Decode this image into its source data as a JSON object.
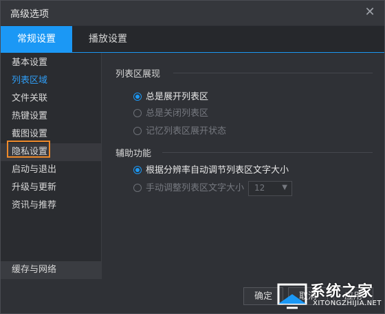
{
  "window": {
    "title": "高级选项",
    "close_glyph": "✕"
  },
  "tabs": [
    {
      "label": "常规设置",
      "active": true
    },
    {
      "label": "播放设置",
      "active": false
    }
  ],
  "sidebar": {
    "items": [
      {
        "label": "基本设置"
      },
      {
        "label": "列表区域",
        "current": true
      },
      {
        "label": "文件关联"
      },
      {
        "label": "热键设置"
      },
      {
        "label": "截图设置"
      },
      {
        "label": "隐私设置",
        "highlighted": true
      },
      {
        "label": "启动与退出"
      },
      {
        "label": "升级与更新"
      },
      {
        "label": "资讯与推荐"
      }
    ],
    "bottom_item": "缓存与网络"
  },
  "content": {
    "list_section": {
      "title": "列表区展现",
      "options": [
        {
          "label": "总是展开列表区",
          "checked": true
        },
        {
          "label": "总是关闭列表区",
          "checked": false
        },
        {
          "label": "记忆列表区展开状态",
          "checked": false
        }
      ]
    },
    "assist_section": {
      "title": "辅助功能",
      "options": [
        {
          "label": "根据分辨率自动调节列表区文字大小",
          "checked": true
        },
        {
          "label": "手动调整列表区文字大小",
          "checked": false
        }
      ],
      "font_size_select": {
        "value": "12"
      }
    }
  },
  "footer": {
    "ok_label": "确定",
    "cancel_label": "取消",
    "apply_label": "应用"
  },
  "watermark": {
    "brand": "系统之家",
    "site": "XITONGZHIJIA.NET"
  },
  "colors": {
    "accent": "#1b98f5",
    "highlight_box": "#f08a2a",
    "background": "#2f3136"
  }
}
